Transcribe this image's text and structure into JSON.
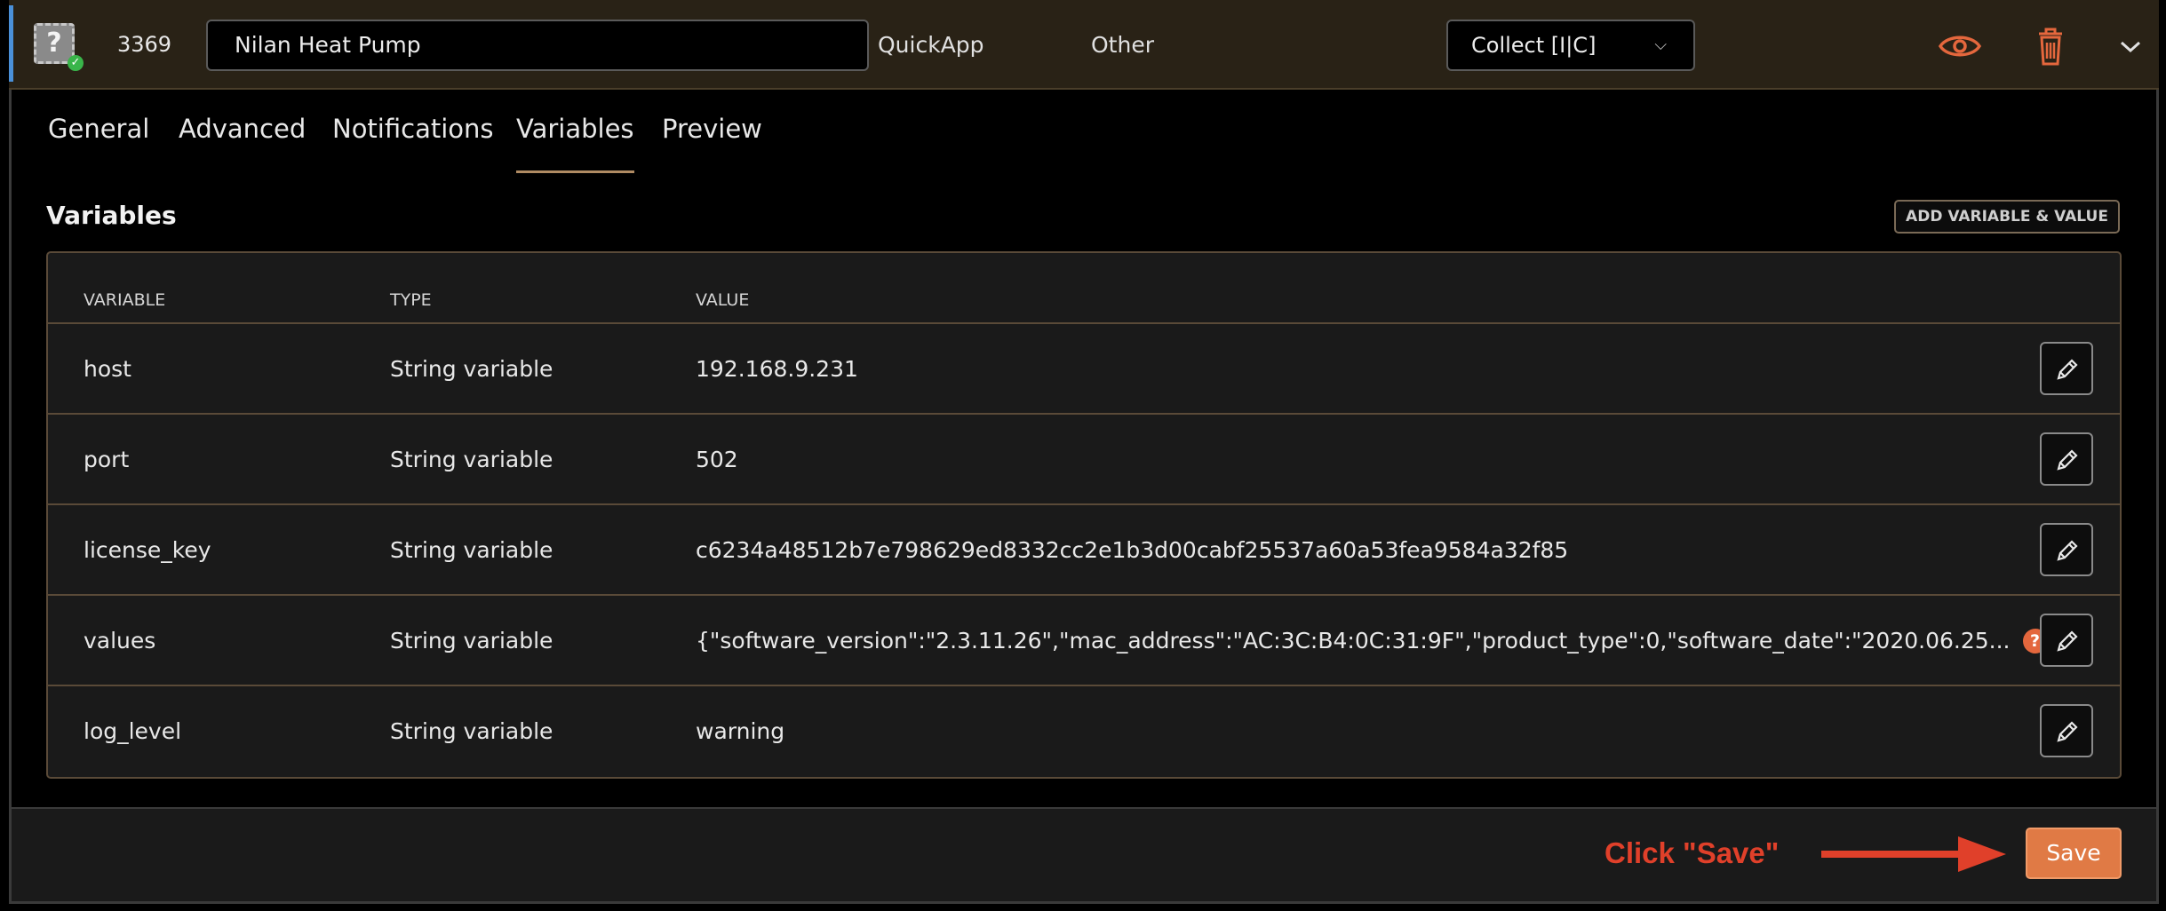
{
  "header": {
    "device_id": "3369",
    "device_name": "Nilan Heat Pump",
    "device_type": "QuickApp",
    "room": "Other",
    "collect_mode": "Collect [I|C]",
    "device_icon_glyph": "?"
  },
  "tabs": [
    {
      "label": "General"
    },
    {
      "label": "Advanced"
    },
    {
      "label": "Notifications"
    },
    {
      "label": "Variables",
      "active": true
    },
    {
      "label": "Preview"
    }
  ],
  "variables_section": {
    "title": "Variables",
    "add_button": "ADD VARIABLE & VALUE",
    "columns": {
      "variable": "VARIABLE",
      "type": "TYPE",
      "value": "VALUE"
    },
    "rows": [
      {
        "variable": "host",
        "type": "String variable",
        "value": "192.168.9.231"
      },
      {
        "variable": "port",
        "type": "String variable",
        "value": "502"
      },
      {
        "variable": "license_key",
        "type": "String variable",
        "value": "c6234a48512b7e798629ed8332cc2e1b3d00cabf25537a60a53fea9584a32f85"
      },
      {
        "variable": "values",
        "type": "String variable",
        "value": "{\"software_version\":\"2.3.11.26\",\"mac_address\":\"AC:3C:B4:0C:31:9F\",\"product_type\":0,\"software_date\":\"2020.06.25...",
        "help_glyph": "?"
      },
      {
        "variable": "log_level",
        "type": "String variable",
        "value": "warning"
      }
    ]
  },
  "footer": {
    "annotation": "Click \"Save\"",
    "save_label": "Save"
  },
  "colors": {
    "accent": "#e07a45",
    "annotation": "#e0402a",
    "header_bg": "#292216",
    "border": "#5a4a38"
  },
  "icons": [
    "device-icon",
    "eye-icon",
    "trash-icon",
    "chevron-down-icon",
    "pencil-icon",
    "help-icon",
    "arrow-icon"
  ]
}
